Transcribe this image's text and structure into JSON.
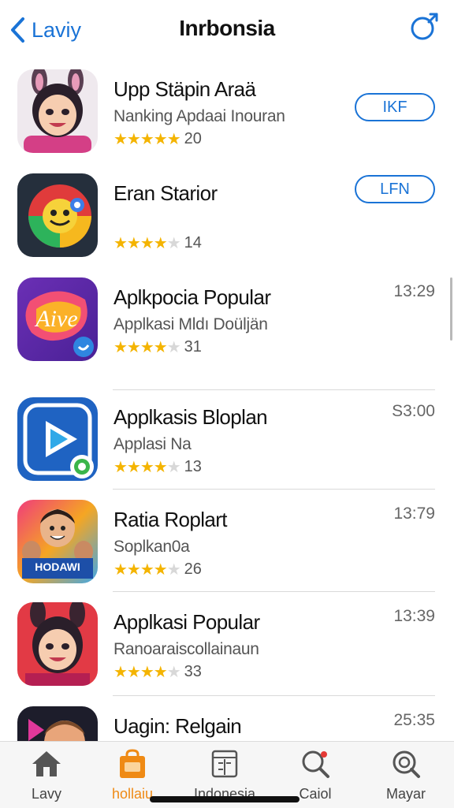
{
  "header": {
    "back_label": "Laviy",
    "title": "Inrbonsia",
    "back_icon": "chevron-left-icon",
    "share_icon": "share-icon"
  },
  "apps": [
    {
      "name": "Upp Stäpin Araä",
      "subtitle": "Nanking Apdaai Inouran",
      "rating_stars": 5,
      "rating_count": "20",
      "action": "IKF",
      "time": ""
    },
    {
      "name": "Eran Starior",
      "subtitle": "",
      "rating_stars": 4.5,
      "rating_count": "14",
      "action": "LFN",
      "time": ""
    },
    {
      "name": "Aplkpocia Popular",
      "subtitle": "Applkasi Mldı Doüljän",
      "rating_stars": 4.5,
      "rating_count": "31",
      "action": "",
      "time": "13:29"
    },
    {
      "name": "Applkasis Bloplan",
      "subtitle": "Applasi Na",
      "rating_stars": 4.5,
      "rating_count": "13",
      "action": "",
      "time": "S3:00"
    },
    {
      "name": "Ratia Roplart",
      "subtitle": "Soplkan0a",
      "rating_stars": 4.5,
      "rating_count": "26",
      "action": "",
      "time": "13:79"
    },
    {
      "name": "Applkasi Popular",
      "subtitle": "Ranoaraiscollainaun",
      "rating_stars": 4.5,
      "rating_count": "33",
      "action": "",
      "time": "13:39"
    },
    {
      "name": "Uagin: Relgain",
      "subtitle": "",
      "rating_stars": 0,
      "rating_count": "",
      "action": "",
      "time": "25:35"
    }
  ],
  "tabbar": {
    "tabs": [
      {
        "label": "Lavy",
        "icon": "home-icon",
        "active": false
      },
      {
        "label": "hollaiu",
        "icon": "bag-icon",
        "active": true
      },
      {
        "label": "Indonesia",
        "icon": "calendar-icon",
        "active": false
      },
      {
        "label": "Caiol",
        "icon": "search-icon",
        "active": false
      },
      {
        "label": "Mayar",
        "icon": "search-icon",
        "active": false
      }
    ]
  },
  "colors": {
    "accent": "#1a73d6",
    "active_tab": "#ef8a14",
    "star": "#f4b400"
  }
}
